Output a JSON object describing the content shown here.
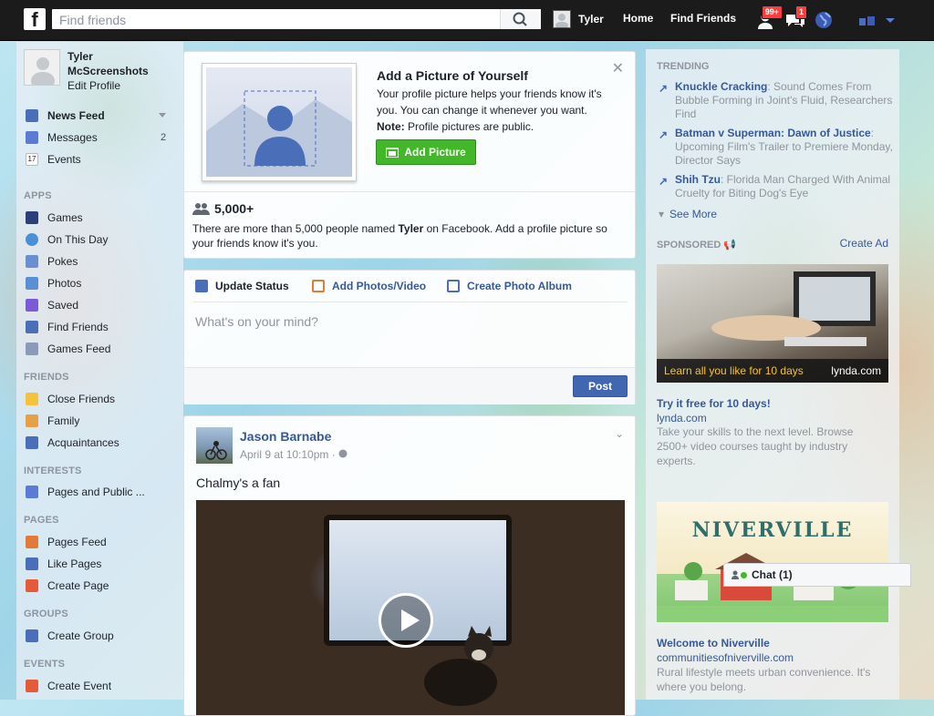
{
  "header": {
    "logo": "f",
    "search_placeholder": "Find friends",
    "profile_name": "Tyler",
    "home": "Home",
    "find_friends": "Find Friends",
    "friend_requests_badge": "99+",
    "messages_badge": "1"
  },
  "sidebar": {
    "name": "Tyler McScreenshots",
    "edit_profile": "Edit Profile",
    "favorites": [
      {
        "label": "News Feed",
        "icon": "news-feed-icon"
      },
      {
        "label": "Messages",
        "icon": "messages-icon",
        "count": "2"
      },
      {
        "label": "Events",
        "icon": "calendar-icon",
        "glyph": "17"
      }
    ],
    "apps_heading": "APPS",
    "apps": [
      {
        "label": "Games",
        "icon": "games-icon"
      },
      {
        "label": "On This Day",
        "icon": "on-this-day-icon"
      },
      {
        "label": "Pokes",
        "icon": "pokes-icon"
      },
      {
        "label": "Photos",
        "icon": "photos-icon"
      },
      {
        "label": "Saved",
        "icon": "saved-icon"
      },
      {
        "label": "Find Friends",
        "icon": "find-friends-icon"
      },
      {
        "label": "Games Feed",
        "icon": "games-feed-icon"
      }
    ],
    "friends_heading": "FRIENDS",
    "friends": [
      {
        "label": "Close Friends",
        "icon": "star-icon"
      },
      {
        "label": "Family",
        "icon": "family-icon"
      },
      {
        "label": "Acquaintances",
        "icon": "acquaintances-icon"
      }
    ],
    "interests_heading": "INTERESTS",
    "interests": [
      {
        "label": "Pages and Public ...",
        "icon": "pages-list-icon"
      }
    ],
    "pages_heading": "PAGES",
    "pages": [
      {
        "label": "Pages Feed",
        "icon": "megaphone-icon"
      },
      {
        "label": "Like Pages",
        "icon": "thumbs-up-icon"
      },
      {
        "label": "Create Page",
        "icon": "create-page-icon"
      }
    ],
    "groups_heading": "GROUPS",
    "groups": [
      {
        "label": "Create Group",
        "icon": "create-group-icon"
      }
    ],
    "events_heading": "EVENTS",
    "events": [
      {
        "label": "Create Event",
        "icon": "create-event-icon"
      }
    ]
  },
  "profile_prompt": {
    "title": "Add a Picture of Yourself",
    "desc": "Your profile picture helps your friends know it's you. You can change it whenever you want.",
    "note_label": "Note:",
    "note_text": " Profile pictures are public.",
    "button": "Add Picture",
    "count": "5,000+",
    "foot_pre": "There are more than 5,000 people named ",
    "foot_name": "Tyler",
    "foot_post": " on Facebook. Add a profile picture so your friends know it's you."
  },
  "composer": {
    "tab_status": "Update Status",
    "tab_photos": "Add Photos/Video",
    "tab_album": "Create Photo Album",
    "placeholder": "What's on your mind?",
    "post": "Post"
  },
  "post": {
    "author": "Jason Barnabe",
    "time": "April 9 at 10:10pm",
    "privacy_icon": "globe-icon",
    "text": "Chalmy's a fan"
  },
  "right": {
    "trending_heading": "TRENDING",
    "trending": [
      {
        "topic": "Knuckle Cracking",
        "text": ": Sound Comes From Bubble Forming in Joint's Fluid, Researchers Find"
      },
      {
        "topic": "Batman v Superman: Dawn of Justice",
        "text": ": Upcoming Film's Trailer to Premiere Monday, Director Says"
      },
      {
        "topic": "Shih Tzu",
        "text": ": Florida Man Charged With Animal Cruelty for Biting Dog's Eye"
      }
    ],
    "see_more": "See More",
    "sponsored_heading": "SPONSORED",
    "create_ad": "Create Ad",
    "ad1": {
      "banner_text": "Learn all you like for 10 days",
      "brand": "lynda.com",
      "title": "Try it free for 10 days!",
      "url": "lynda.com",
      "body": "Take your skills to the next level. Browse 2500+ video courses taught by industry experts."
    },
    "ad2": {
      "banner_text": "NIVERVILLE",
      "title": "Welcome to Niverville",
      "url": "communitiesofniverville.com",
      "body": "Rural lifestyle meets urban convenience. It's where you belong."
    }
  },
  "chat": {
    "label": "Chat (1)"
  }
}
